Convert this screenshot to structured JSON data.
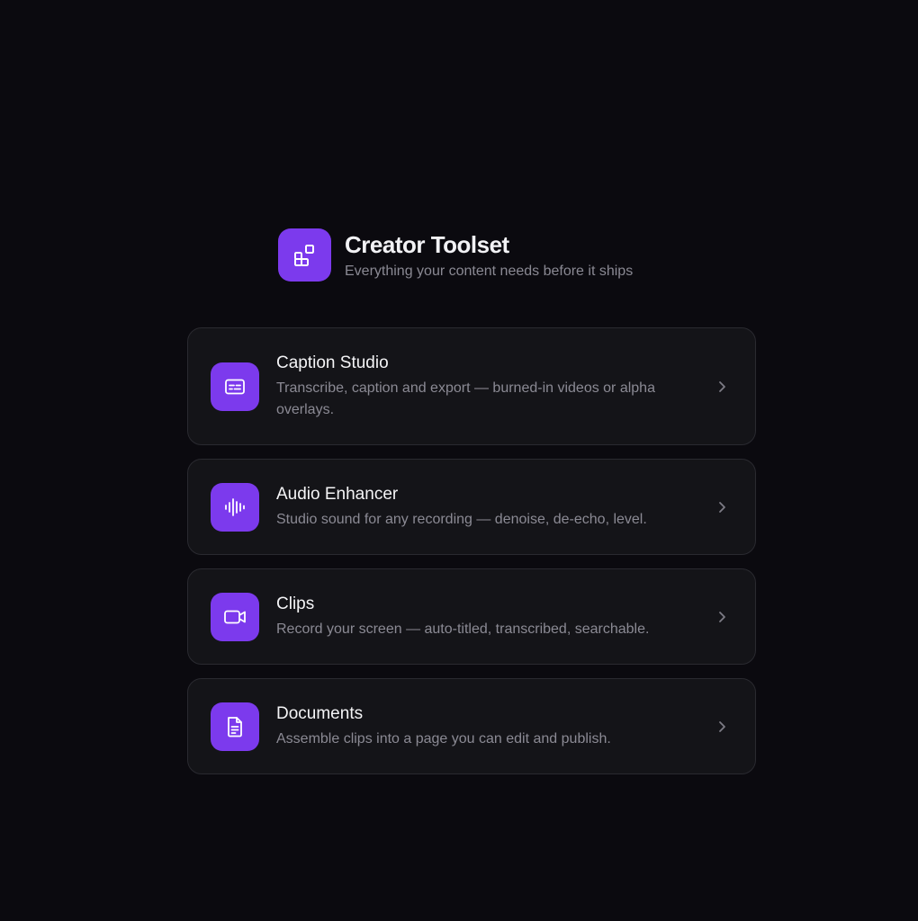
{
  "header": {
    "title": "Creator Toolset",
    "subtitle": "Everything your content needs before it ships",
    "logo_icon": "grid-apps-icon"
  },
  "colors": {
    "background": "#0b0a0f",
    "accent": "#7c3aed",
    "card": "#141418",
    "card_border": "#2a2a30"
  },
  "tools": [
    {
      "title": "Caption Studio",
      "description": "Transcribe, caption and export — burned-in videos or alpha overlays.",
      "icon": "captions-icon"
    },
    {
      "title": "Audio Enhancer",
      "description": "Studio sound for any recording — denoise, de-echo, level.",
      "icon": "audio-waveform-icon"
    },
    {
      "title": "Clips",
      "description": "Record your screen — auto-titled, transcribed, searchable.",
      "icon": "video-camera-icon"
    },
    {
      "title": "Documents",
      "description": "Assemble clips into a page you can edit and publish.",
      "icon": "document-icon"
    }
  ]
}
